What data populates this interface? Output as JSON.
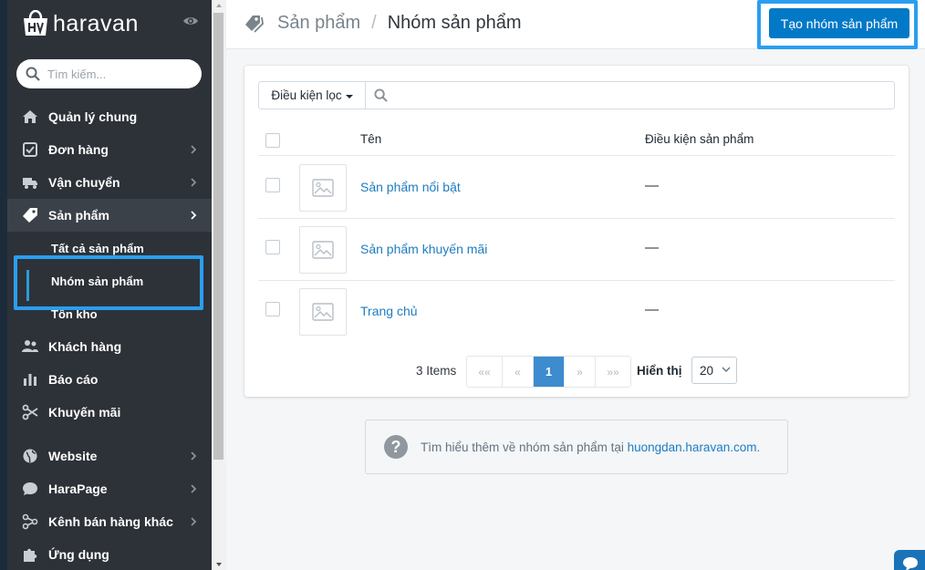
{
  "brand": {
    "name": "haravan"
  },
  "sidebar": {
    "search_placeholder": "Tìm kiếm...",
    "items": [
      {
        "label": "Quản lý chung",
        "icon": "home-icon"
      },
      {
        "label": "Đơn hàng",
        "icon": "check-square-icon",
        "chevron": true
      },
      {
        "label": "Vận chuyển",
        "icon": "truck-icon",
        "chevron": true
      },
      {
        "label": "Sản phẩm",
        "icon": "tag-icon",
        "chevron": true,
        "active": true
      }
    ],
    "sub_items": [
      {
        "label": "Tất cả sản phẩm"
      },
      {
        "label": "Nhóm sản phẩm",
        "selected": true
      },
      {
        "label": "Tồn kho"
      }
    ],
    "items2": [
      {
        "label": "Khách hàng",
        "icon": "users-icon"
      },
      {
        "label": "Báo cáo",
        "icon": "bar-chart-icon"
      },
      {
        "label": "Khuyến mãi",
        "icon": "scissors-icon"
      }
    ],
    "items3": [
      {
        "label": "Website",
        "icon": "globe-icon",
        "chevron": true
      },
      {
        "label": "HaraPage",
        "icon": "chat-bubble-icon",
        "chevron": true
      },
      {
        "label": "Kênh bán hàng khác",
        "icon": "share-icon",
        "chevron": true
      },
      {
        "label": "Ứng dụng",
        "icon": "puzzle-icon"
      }
    ]
  },
  "header": {
    "breadcrumb_parent": "Sản phẩm",
    "breadcrumb_sep": "/",
    "title": "Nhóm sản phẩm",
    "create_button": "Tạo nhóm sản phẩm"
  },
  "filter": {
    "button_label": "Điều kiện lọc",
    "search_value": ""
  },
  "table": {
    "columns": [
      "Tên",
      "Điều kiện sản phẩm"
    ],
    "rows": [
      {
        "name": "Sản phẩm nổi bật",
        "condition": "—"
      },
      {
        "name": "Sản phẩm khuyến mãi",
        "condition": "—"
      },
      {
        "name": "Trang chủ",
        "condition": "—"
      }
    ]
  },
  "pagination": {
    "count_text": "3 Items",
    "first": "««",
    "prev": "«",
    "current": "1",
    "next": "»",
    "last": "»»",
    "show_label": "Hiển thị",
    "page_size": "20"
  },
  "help": {
    "text": "Tìm hiểu thêm về nhóm sản phẩm tại ",
    "link": "huongdan.haravan.com",
    "suffix": "."
  },
  "colors": {
    "sidebar_bg": "#2d3238",
    "primary": "#0279c7",
    "link": "#1e7dc0",
    "highlight": "#2a9ef0"
  }
}
